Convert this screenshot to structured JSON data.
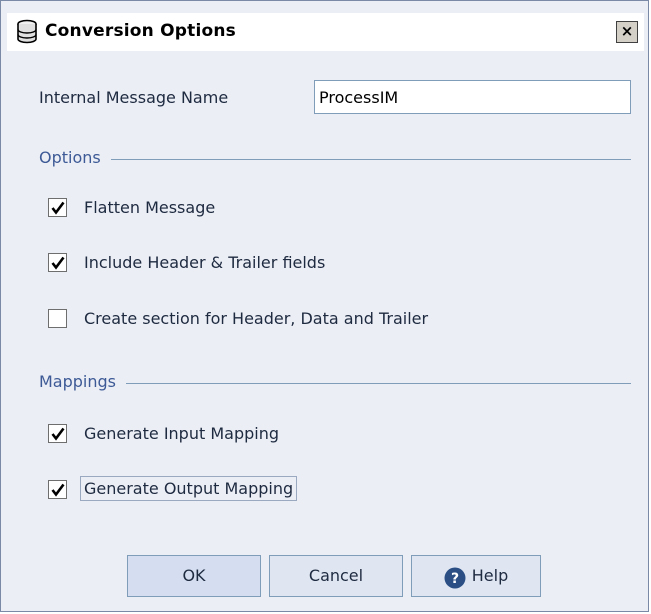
{
  "window": {
    "title": "Conversion Options",
    "close_glyph": "×",
    "icon": "database-icon"
  },
  "form": {
    "internal_message_label": "Internal Message Name",
    "internal_message_value": "ProcessIM"
  },
  "options_section": {
    "title": "Options",
    "items": [
      {
        "label": "Flatten Message",
        "checked": true
      },
      {
        "label": "Include Header & Trailer fields",
        "checked": true
      },
      {
        "label": "Create section for Header, Data and Trailer",
        "checked": false
      }
    ]
  },
  "mappings_section": {
    "title": "Mappings",
    "items": [
      {
        "label": "Generate Input Mapping",
        "checked": true
      },
      {
        "label": "Generate Output Mapping",
        "checked": true,
        "focused": true
      }
    ]
  },
  "buttons": {
    "ok": "OK",
    "cancel": "Cancel",
    "help": "Help",
    "help_icon": "help-icon"
  },
  "colors": {
    "dialog_background": "#ebeef5",
    "section_title": "#3d5a96",
    "help_icon": "#2b4f85"
  }
}
